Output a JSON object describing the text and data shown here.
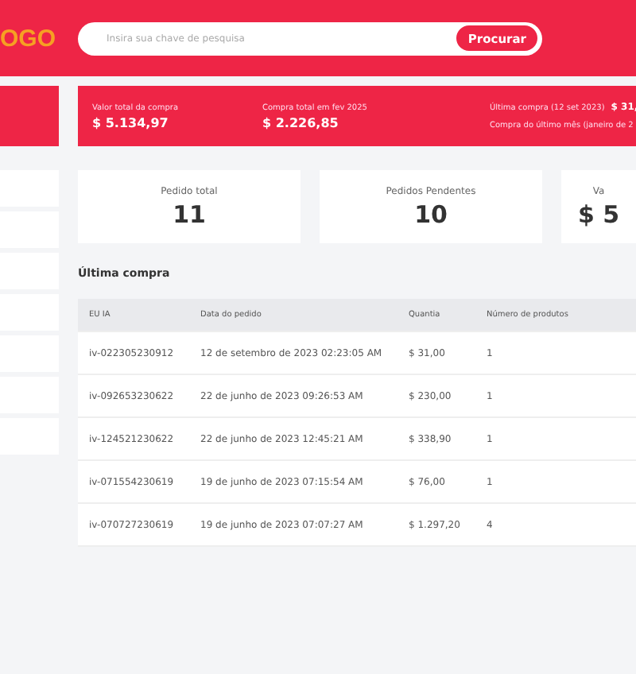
{
  "header": {
    "logo": "OGO",
    "search": {
      "placeholder": "Insira sua chave de pesquisa",
      "button": "Procurar"
    }
  },
  "sidebar": {
    "items": [
      {
        "kind": "blank"
      },
      {
        "kind": "blank"
      },
      {
        "kind": "blank"
      },
      {
        "kind": "blank"
      },
      {
        "kind": "blank"
      },
      {
        "kind": "blank"
      },
      {
        "kind": "blank"
      }
    ]
  },
  "summary": {
    "stats": [
      {
        "label": "Valor total da compra",
        "value": "$ 5.134,97"
      },
      {
        "label": "Compra total em fev 2025",
        "value": "$ 2.226,85"
      }
    ],
    "last_purchase": {
      "label": "Última compra (12 set 2023)",
      "value": "$ 31,"
    },
    "last_month": "Compra do último mês (janeiro de 2"
  },
  "cards": [
    {
      "label": "Pedido total",
      "value": "11"
    },
    {
      "label": "Pedidos Pendentes",
      "value": "10"
    },
    {
      "label": "Va",
      "value": "$ 5"
    }
  ],
  "table": {
    "title": "Última compra",
    "columns": [
      "EU IA",
      "Data do pedido",
      "Quantia",
      "Número de produtos"
    ],
    "rows": [
      [
        "iv-022305230912",
        "12 de setembro de 2023 02:23:05 AM",
        "$ 31,00",
        "1"
      ],
      [
        "iv-092653230622",
        "22 de junho de 2023 09:26:53 AM",
        "$ 230,00",
        "1"
      ],
      [
        "iv-124521230622",
        "22 de junho de 2023 12:45:21 AM",
        "$ 338,90",
        "1"
      ],
      [
        "iv-071554230619",
        "19 de junho de 2023 07:15:54 AM",
        "$ 76,00",
        "1"
      ],
      [
        "iv-070727230619",
        "19 de junho de 2023 07:07:27 AM",
        "$ 1.297,20",
        "4"
      ]
    ]
  }
}
